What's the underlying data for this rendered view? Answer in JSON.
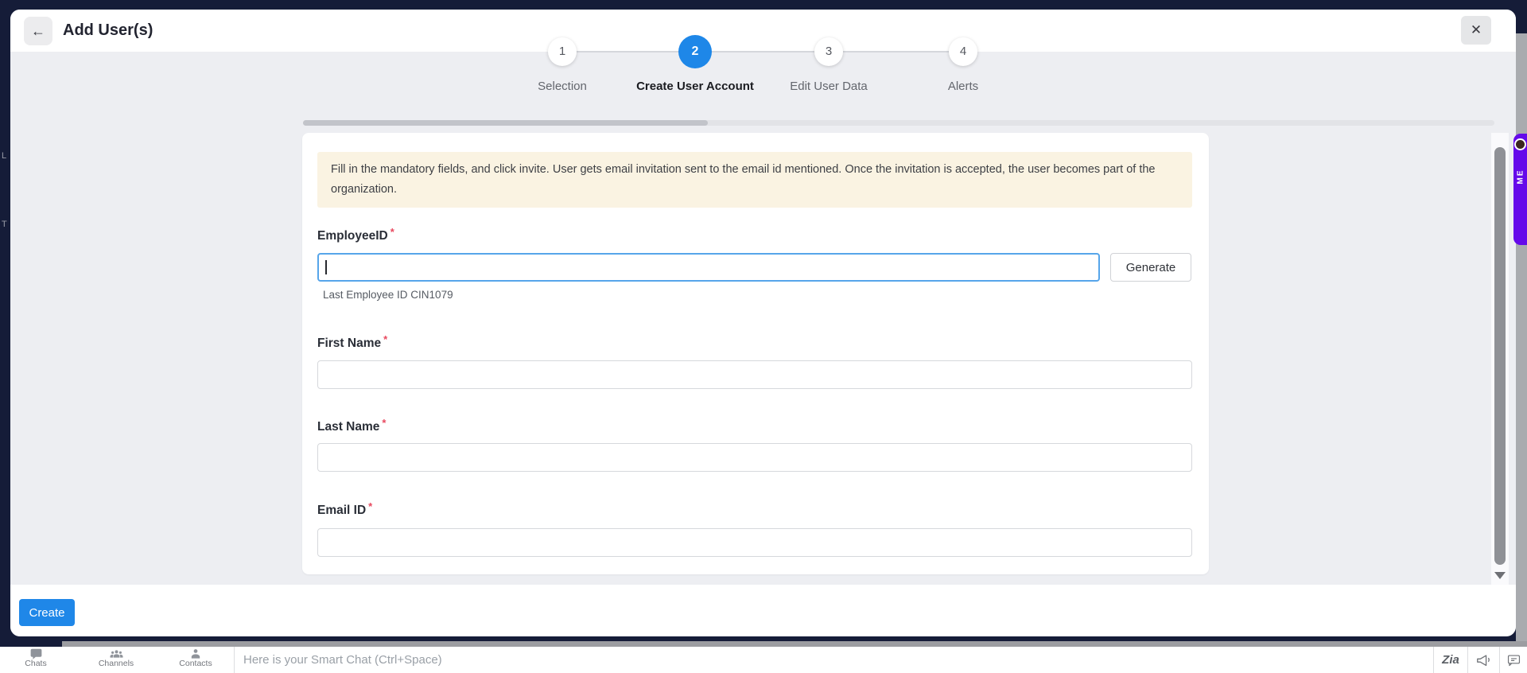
{
  "window": {
    "left_edge_letters": [
      "L",
      "T"
    ]
  },
  "modal": {
    "title": "Add User(s)",
    "icons": {
      "back": "←",
      "close": "✕"
    },
    "stepper": {
      "active_step": "2",
      "steps": [
        {
          "number": "1",
          "label": "Selection"
        },
        {
          "number": "2",
          "label": "Create User Account"
        },
        {
          "number": "3",
          "label": "Edit User Data"
        },
        {
          "number": "4",
          "label": "Alerts"
        }
      ]
    },
    "form": {
      "info_banner": "Fill in the mandatory fields, and click invite. User gets email invitation sent to the email id mentioned. Once the invitation is accepted, the user becomes part of the organization.",
      "fields": [
        {
          "label": "EmployeeID",
          "required": "*",
          "value": "",
          "hint": "Last Employee ID CIN1079"
        },
        {
          "label": "First Name",
          "required": "*",
          "value": ""
        },
        {
          "label": "Last Name",
          "required": "*",
          "value": ""
        },
        {
          "label": "Email ID",
          "required": "*",
          "value": ""
        }
      ],
      "generate_button": "Generate"
    },
    "footer": {
      "create_button": "Create"
    }
  },
  "bottom_bar": {
    "nav_items": [
      {
        "label": "Chats"
      },
      {
        "label": "Channels"
      },
      {
        "label": "Contacts"
      }
    ],
    "smart_chat_placeholder": "Here is your Smart Chat (Ctrl+Space)",
    "zia_label": "Zia"
  },
  "side_widget": {
    "label": "ME"
  },
  "colors": {
    "accent_blue": "#1e87e8",
    "focus_border": "#56a5ea",
    "banner_bg": "#faf3e2",
    "required_red": "#e8495f",
    "navy_bg": "#151c38",
    "widget_purple": "#6509ea"
  }
}
